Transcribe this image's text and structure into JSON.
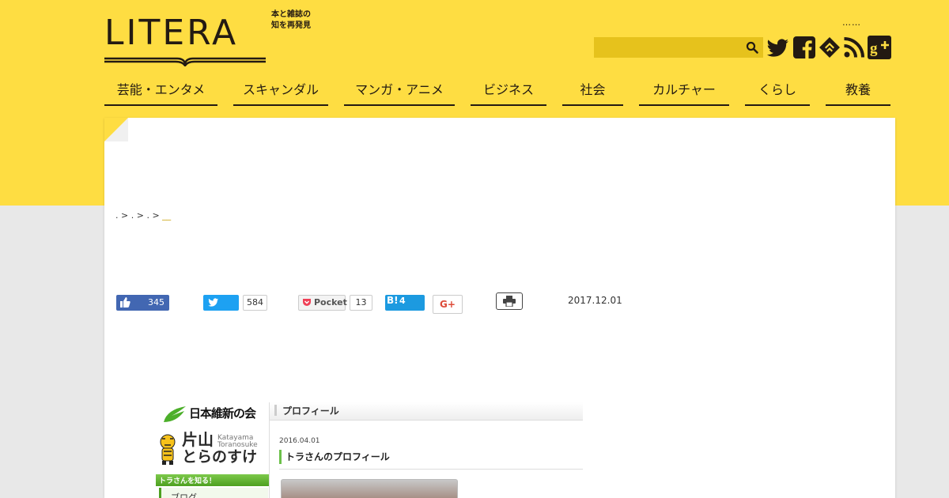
{
  "site": {
    "logo_text": "LITERA",
    "tagline_line1": "本と雑誌の",
    "tagline_line2": "知を再発見",
    "dots": "……"
  },
  "search": {
    "placeholder": ""
  },
  "social_icons": [
    "twitter-icon",
    "facebook-icon",
    "feedly-icon",
    "rss-icon",
    "google-plus-icon"
  ],
  "nav": {
    "items": [
      {
        "label": "芸能・エンタメ"
      },
      {
        "label": "スキャンダル"
      },
      {
        "label": "マンガ・アニメ"
      },
      {
        "label": "ビジネス"
      },
      {
        "label": "社会"
      },
      {
        "label": "カルチャー"
      },
      {
        "label": "くらし"
      },
      {
        "label": "教養"
      }
    ]
  },
  "breadcrumb": {
    "sep": ">",
    "current": "__"
  },
  "share": {
    "fb_count": "345",
    "tw_count": "584",
    "pocket_label": "Pocket",
    "pocket_count": "13",
    "hb_label": "B!",
    "hb_count": "4",
    "gplus_label": "G+"
  },
  "article": {
    "date": "2017.12.01"
  },
  "embedded_image": {
    "party": "日本維新の会",
    "name_kanji": "片山",
    "name_kana": "とらのすけ",
    "name_roman_1": "Katayama",
    "name_roman_2": "Toranosuke",
    "side_link": "トラさんを知る！",
    "side_item": "ブログ",
    "header": "プロフィール",
    "post_date": "2016.04.01",
    "post_title": "トラさんのプロフィール"
  },
  "colors": {
    "brand_yellow": "#fedd42",
    "dark": "#231a12",
    "background_gray": "#e8e8e8"
  }
}
